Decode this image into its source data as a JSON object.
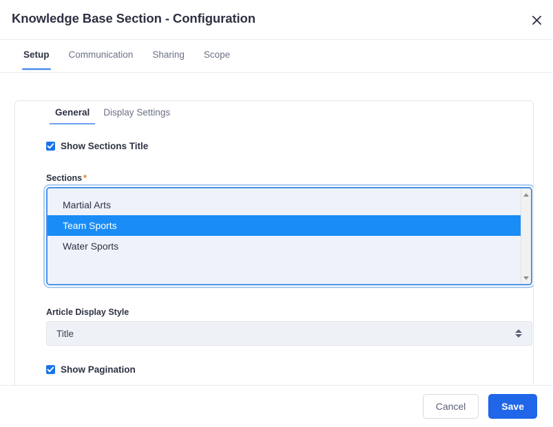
{
  "header": {
    "title": "Knowledge Base Section - Configuration",
    "close_icon": "close-icon"
  },
  "top_tabs": [
    {
      "label": "Setup",
      "active": true
    },
    {
      "label": "Communication",
      "active": false
    },
    {
      "label": "Sharing",
      "active": false
    },
    {
      "label": "Scope",
      "active": false
    }
  ],
  "card": {
    "tabs": [
      {
        "label": "General",
        "active": true
      },
      {
        "label": "Display Settings",
        "active": false
      }
    ],
    "show_sections_title": {
      "label": "Show Sections Title",
      "checked": true
    },
    "sections_field": {
      "label": "Sections",
      "required_marker": "*",
      "options": [
        {
          "label": "Martial Arts",
          "selected": false
        },
        {
          "label": "Team Sports",
          "selected": true
        },
        {
          "label": "Water Sports",
          "selected": false
        }
      ]
    },
    "article_display_style": {
      "label": "Article Display Style",
      "value": "Title"
    },
    "show_pagination": {
      "label": "Show Pagination",
      "checked": true
    }
  },
  "footer": {
    "cancel_label": "Cancel",
    "save_label": "Save"
  },
  "colors": {
    "accent_blue": "#1f66e8",
    "selection_blue": "#1a8cf5",
    "tab_underline": "#6c9ef0",
    "required_orange": "#d2821a",
    "text_dark": "#2d3142",
    "text_muted": "#6b7086"
  }
}
